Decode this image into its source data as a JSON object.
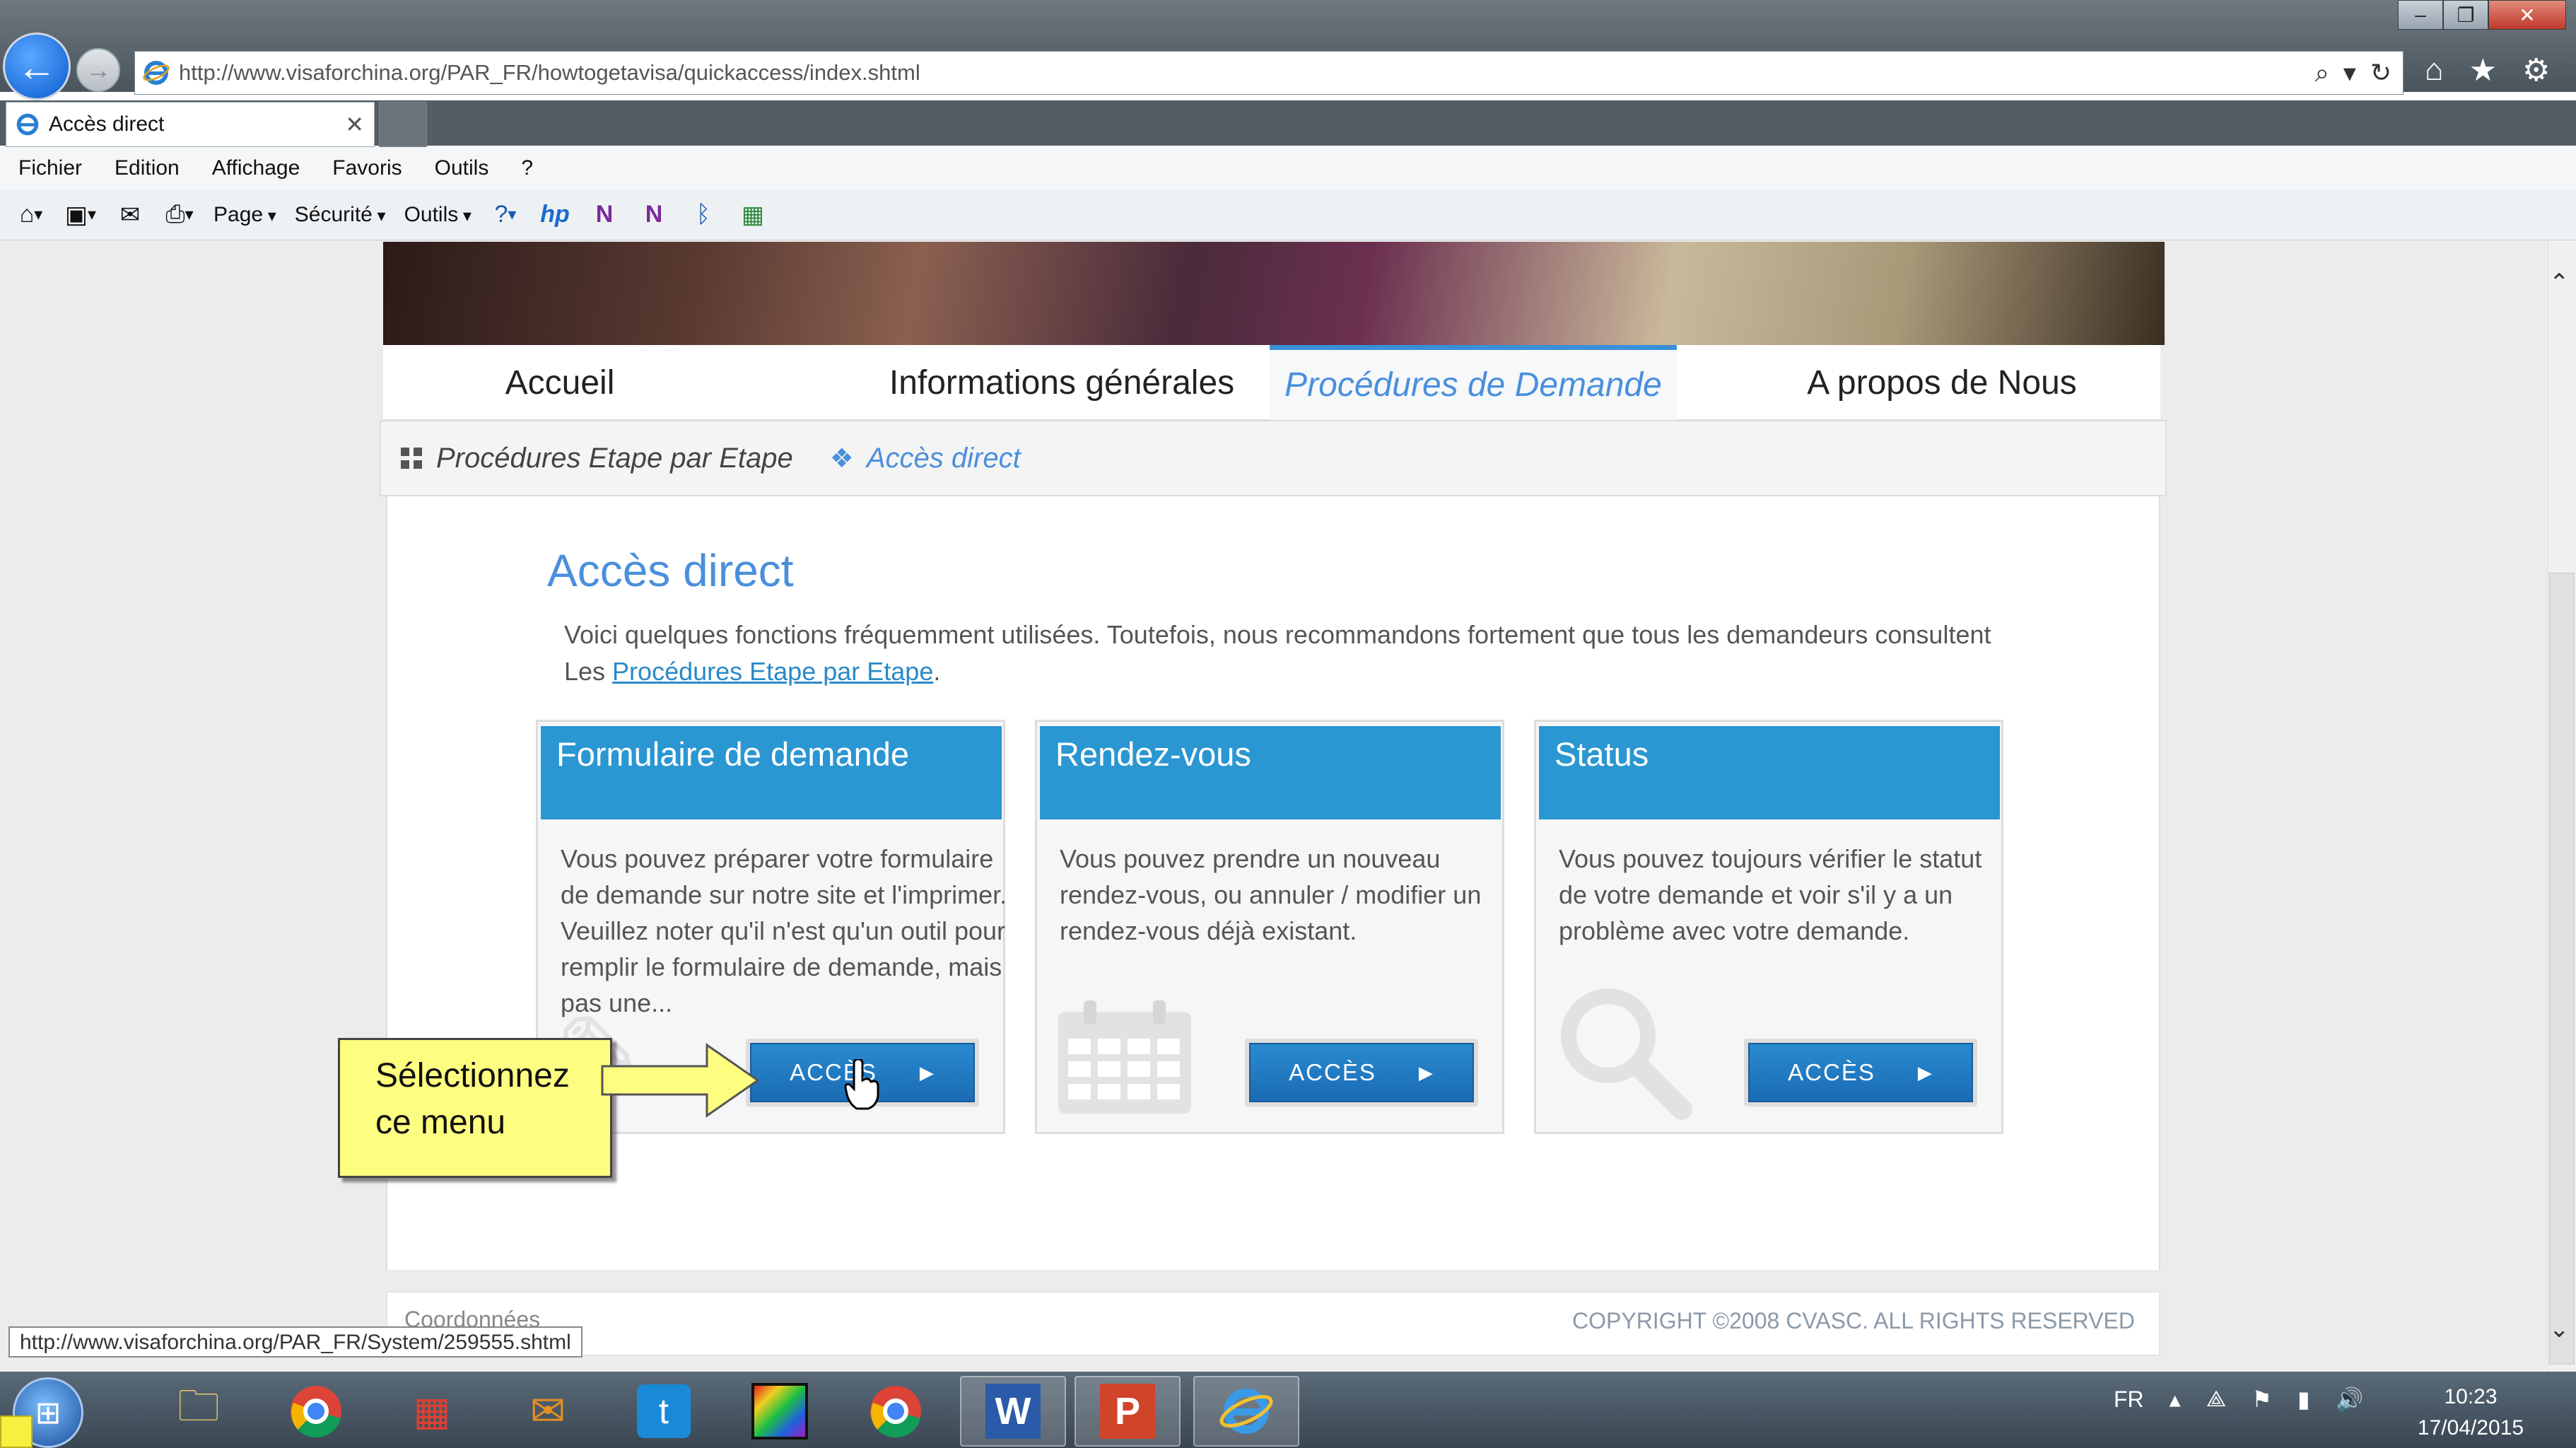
{
  "browser": {
    "address": "http://www.visaforchina.org/PAR_FR/howtogetavisa/quickaccess/index.shtml",
    "tab_title": "Accès direct",
    "menu": [
      "Fichier",
      "Edition",
      "Affichage",
      "Favoris",
      "Outils",
      "?"
    ],
    "commands": {
      "page": "Page",
      "security": "Sécurité",
      "tools": "Outils"
    },
    "status_url": "http://www.visaforchina.org/PAR_FR/System/259555.shtml"
  },
  "site": {
    "nav": [
      "Accueil",
      "Informations générales",
      "Procédures de Demande",
      "A propos de Nous"
    ],
    "subnav": {
      "item1": "Procédures Etape par Etape",
      "item2": "Accès direct"
    },
    "title": "Accès direct",
    "intro_text": "Voici quelques fonctions fréquemment utilisées. Toutefois, nous recommandons fortement que tous les demandeurs consultent Les ",
    "intro_link": "Procédures Etape par Etape",
    "intro_end": ".",
    "cards": [
      {
        "title": "Formulaire de demande",
        "body": "Vous pouvez préparer votre formulaire de demande sur notre site et l'imprimer. Veuillez noter qu'il n'est qu'un outil pour remplir le formulaire de demande, mais pas une...",
        "button": "ACCÈS"
      },
      {
        "title": "Rendez-vous",
        "body": "Vous pouvez prendre un nouveau rendez-vous, ou annuler / modifier un rendez-vous déjà existant.",
        "button": "ACCÈS"
      },
      {
        "title": "Status",
        "body": "Vous pouvez toujours vérifier le statut de votre demande et voir s'il y a un problème avec votre demande.",
        "button": "ACCÈS"
      }
    ],
    "footer_left": "Coordonnées",
    "footer_right": "COPYRIGHT ©2008 CVASC. ALL RIGHTS RESERVED"
  },
  "callout": {
    "text": "Sélectionnez ce menu"
  },
  "taskbar": {
    "language": "FR",
    "time": "10:23",
    "date": "17/04/2015",
    "apps": [
      "explorer-icon",
      "chrome-icon",
      "apps-icon",
      "outlook-icon",
      "twitter-icon",
      "media-icon",
      "chrome-icon",
      "word-icon",
      "powerpoint-icon",
      "internet-explorer-icon"
    ]
  },
  "colors": {
    "accent": "#2a96d2",
    "link": "#4a8fdc",
    "callout": "#fdfd80"
  }
}
